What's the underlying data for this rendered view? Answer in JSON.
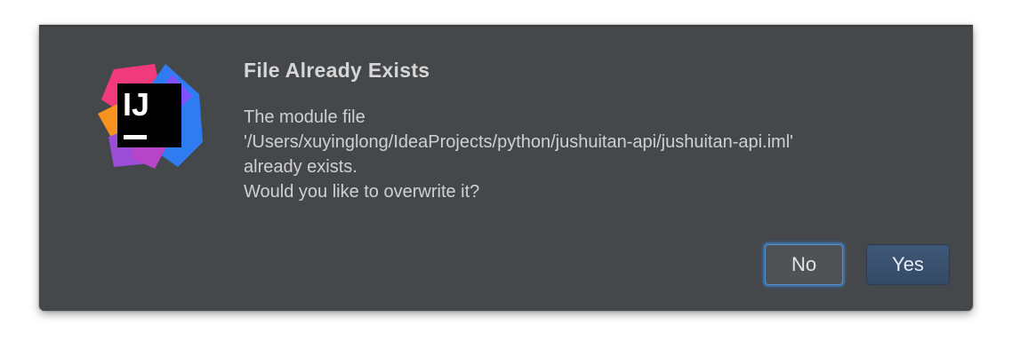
{
  "dialog": {
    "title": "File Already Exists",
    "message_lines": [
      "The module file",
      "'/Users/xuyinglong/IdeaProjects/python/jushuitan-api/jushuitan-api.iml'",
      "already exists.",
      "Would you like to overwrite it?"
    ],
    "logo_icon": "intellij-idea-icon",
    "logo_text": "IJ"
  },
  "buttons": {
    "no_label": "No",
    "yes_label": "Yes"
  },
  "colors": {
    "dialog_background": "#45484b",
    "title_text": "#d6d6d6",
    "focus_ring": "#3a6fa6",
    "default_button": "#3f5777"
  }
}
